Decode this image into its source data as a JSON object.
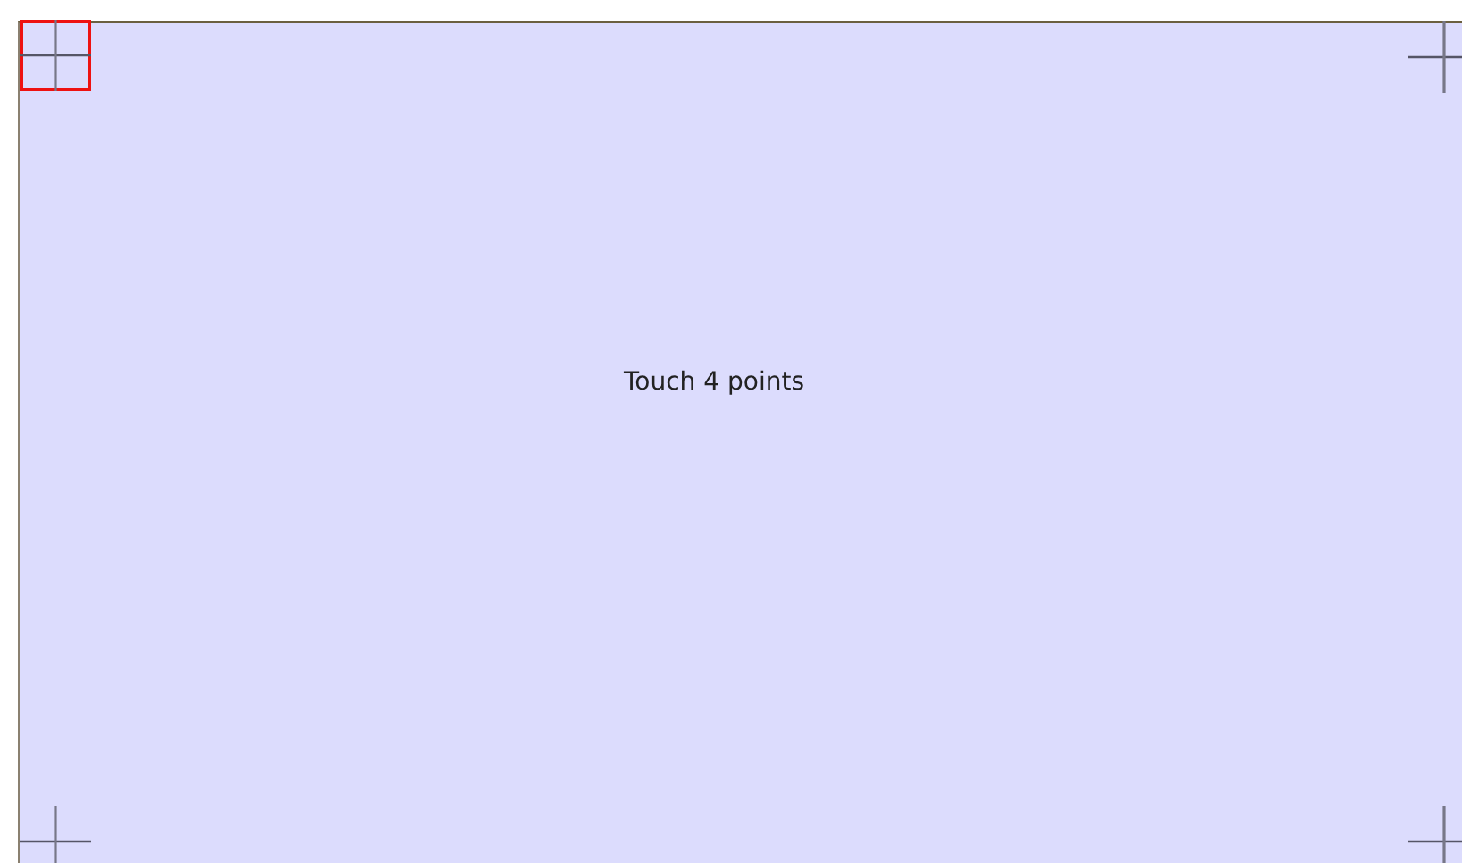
{
  "prompt": "Touch 4 points",
  "targets": [
    {
      "kind": "top-left",
      "selected": true
    },
    {
      "kind": "top-right",
      "selected": false
    },
    {
      "kind": "bottom-left",
      "selected": false
    },
    {
      "kind": "bottom-right",
      "selected": false
    }
  ]
}
